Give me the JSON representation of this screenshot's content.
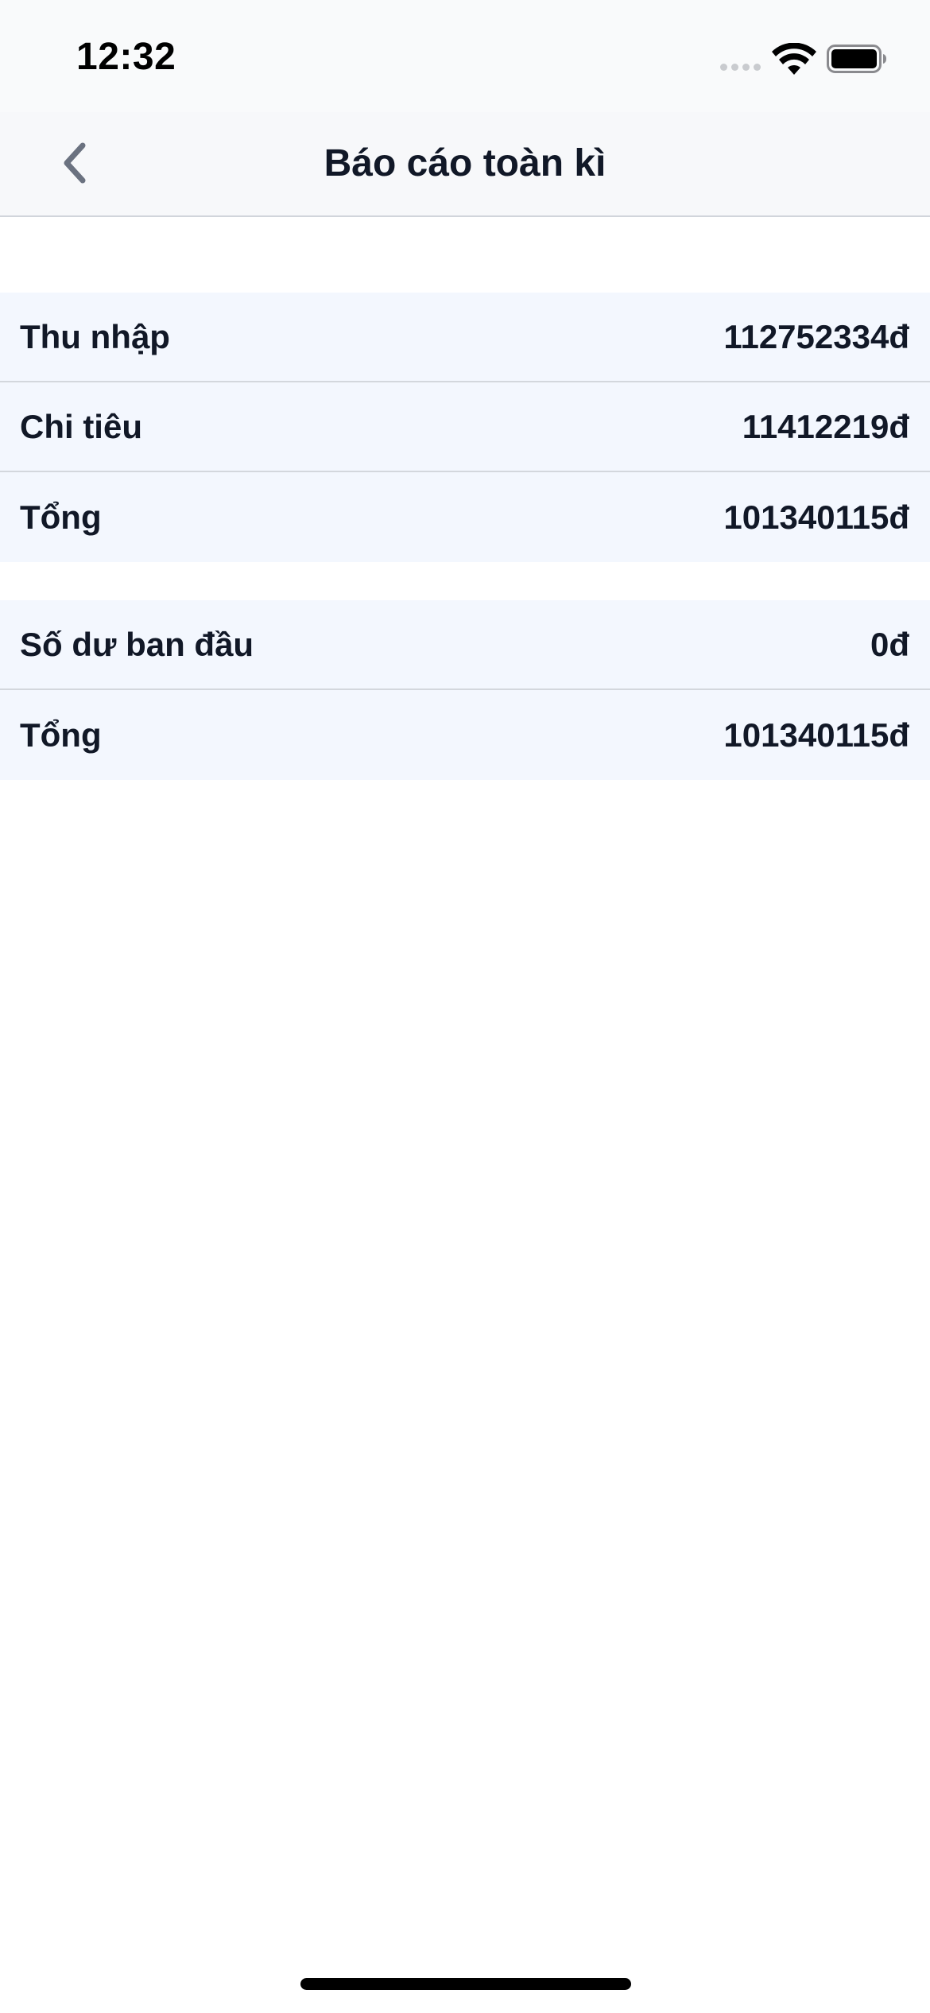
{
  "status_bar": {
    "time": "12:32"
  },
  "nav": {
    "title": "Báo cáo toàn kì",
    "back_icon": "chevron-left-icon"
  },
  "summary_section": {
    "rows": [
      {
        "label": "Thu nhập",
        "value": "112752334đ"
      },
      {
        "label": "Chi tiêu",
        "value": "11412219đ"
      },
      {
        "label": "Tổng",
        "value": "101340115đ"
      }
    ]
  },
  "balance_section": {
    "rows": [
      {
        "label": "Số dư ban đầu",
        "value": "0đ"
      },
      {
        "label": "Tổng",
        "value": "101340115đ"
      }
    ]
  },
  "colors": {
    "background": "#ffffff",
    "row_background": "#f3f7fe",
    "nav_background": "#f7f8fa",
    "text": "#111827",
    "divider": "#d3d7dd"
  }
}
